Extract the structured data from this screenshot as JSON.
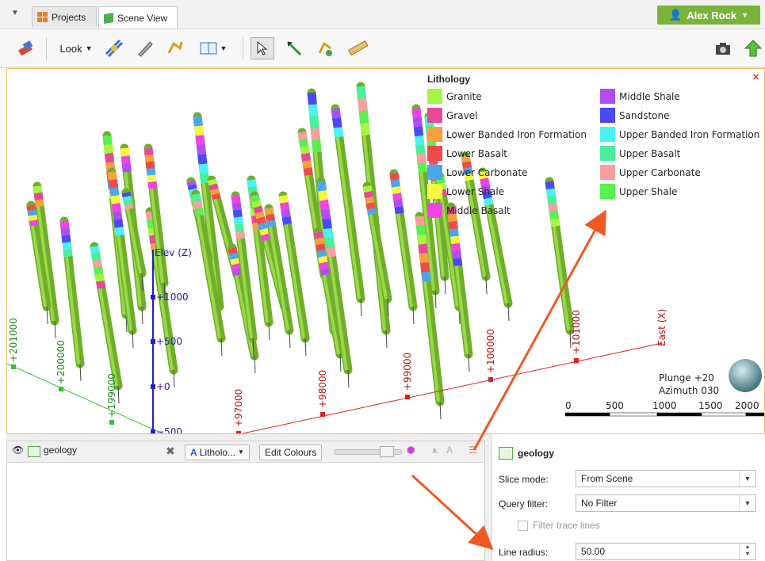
{
  "tabs": {
    "projects_label": "Projects",
    "scene_view_label": "Scene View",
    "user_name": "Alex Rock"
  },
  "toolbar": {
    "look_label": "Look"
  },
  "legend": {
    "title": "Lithology",
    "items": [
      {
        "label": "Granite",
        "color": "#a6f542"
      },
      {
        "label": "Gravel",
        "color": "#e8489a"
      },
      {
        "label": "Lower Banded Iron Formation",
        "color": "#f6a040"
      },
      {
        "label": "Lower Basalt",
        "color": "#ef4b4b"
      },
      {
        "label": "Lower Carbonate",
        "color": "#4aa6ef"
      },
      {
        "label": "Lower Shale",
        "color": "#f7f742"
      },
      {
        "label": "Middle Basalt",
        "color": "#f242e6"
      },
      {
        "label": "Middle Shale",
        "color": "#b04ef2"
      },
      {
        "label": "Sandstone",
        "color": "#4a4af2"
      },
      {
        "label": "Upper Banded Iron Formation",
        "color": "#4af2f2"
      },
      {
        "label": "Upper Basalt",
        "color": "#4aef9a"
      },
      {
        "label": "Upper Carbonate",
        "color": "#f7a0a0"
      },
      {
        "label": "Upper Shale",
        "color": "#58f052"
      }
    ]
  },
  "axes": {
    "elev_label": "Elev (Z)",
    "elev_ticks": [
      "+1000",
      "+500",
      "+0",
      "−500"
    ],
    "east_label": "East (X)",
    "east_ticks": [
      "+97000",
      "+98000",
      "+99000",
      "+100000",
      "+101000"
    ],
    "north_ticks": [
      "+201000",
      "+200000",
      "+199000"
    ]
  },
  "compass": {
    "plunge": "Plunge +20",
    "azimuth": "Azimuth 030"
  },
  "scale_bar": {
    "labels": [
      "0",
      "500",
      "1000",
      "1500",
      "2000"
    ]
  },
  "object_panel": {
    "object_name": "geology",
    "colour_dropdown": "Litholo...",
    "edit_colours_label": "Edit Colours"
  },
  "properties": {
    "title": "geology",
    "slice_mode_label": "Slice mode:",
    "slice_mode_value": "From Scene",
    "query_filter_label": "Query filter:",
    "query_filter_value": "No Filter",
    "filter_trace_label": "Filter trace lines",
    "line_radius_label": "Line radius:",
    "line_radius_value": "50.00"
  }
}
